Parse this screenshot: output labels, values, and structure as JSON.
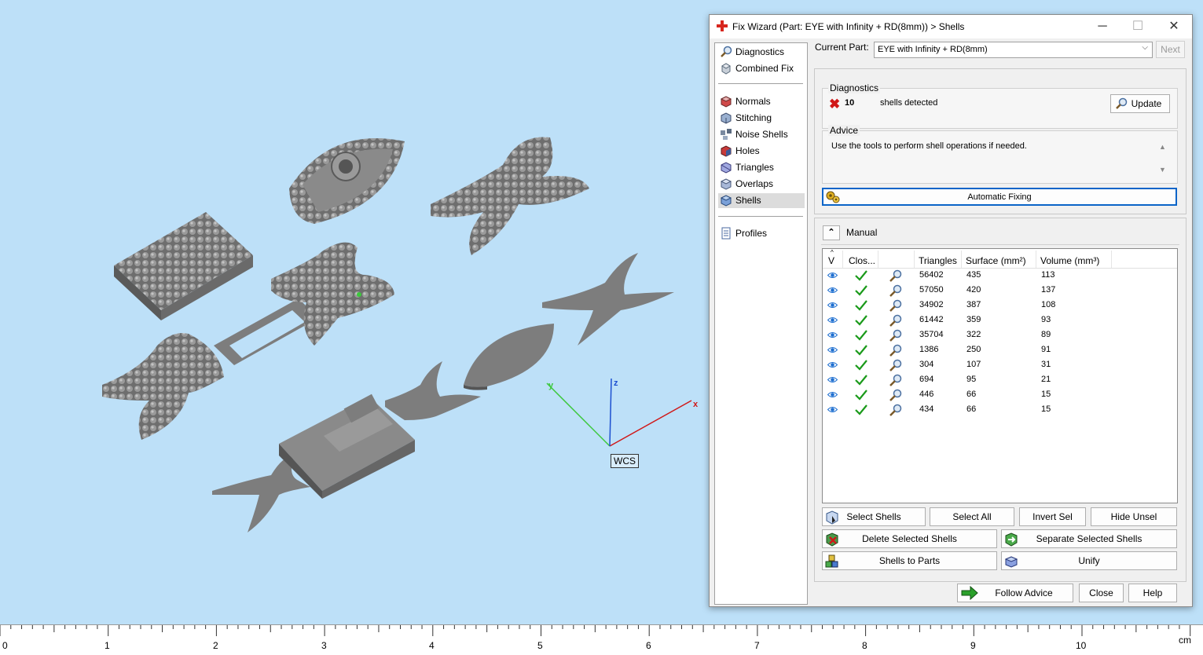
{
  "window": {
    "title": "Fix Wizard (Part: EYE with Infinity + RD(8mm)) > Shells",
    "minimize": "─",
    "maximize": "☐",
    "close": "✕"
  },
  "nav": {
    "items": [
      {
        "label": "Diagnostics",
        "icon": "magnifier-icon"
      },
      {
        "label": "Combined Fix",
        "icon": "cube-icon"
      },
      {
        "label": "Normals",
        "icon": "normals-icon"
      },
      {
        "label": "Stitching",
        "icon": "stitching-icon"
      },
      {
        "label": "Noise Shells",
        "icon": "noise-shells-icon"
      },
      {
        "label": "Holes",
        "icon": "holes-icon"
      },
      {
        "label": "Triangles",
        "icon": "triangles-icon"
      },
      {
        "label": "Overlaps",
        "icon": "overlaps-icon"
      },
      {
        "label": "Shells",
        "icon": "shells-icon"
      },
      {
        "label": "Profiles",
        "icon": "profiles-icon"
      }
    ],
    "selected": "Shells"
  },
  "current_part": {
    "label": "Current Part:",
    "value": "EYE with Infinity + RD(8mm)",
    "next": "Next"
  },
  "diagnostics": {
    "title": "Diagnostics",
    "count": "10",
    "text": "shells detected",
    "update": "Update"
  },
  "advice": {
    "title": "Advice",
    "text": "Use the tools to perform shell operations if needed."
  },
  "automatic_fixing": "Automatic Fixing",
  "manual": {
    "title": "Manual",
    "columns": [
      "V",
      "Clos...",
      "",
      "Triangles",
      "Surface (mm²)",
      "Volume (mm³)"
    ],
    "rows": [
      {
        "triangles": "56402",
        "surface": "435",
        "volume": "113"
      },
      {
        "triangles": "57050",
        "surface": "420",
        "volume": "137"
      },
      {
        "triangles": "34902",
        "surface": "387",
        "volume": "108"
      },
      {
        "triangles": "61442",
        "surface": "359",
        "volume": "93"
      },
      {
        "triangles": "35704",
        "surface": "322",
        "volume": "89"
      },
      {
        "triangles": "1386",
        "surface": "250",
        "volume": "91"
      },
      {
        "triangles": "304",
        "surface": "107",
        "volume": "31"
      },
      {
        "triangles": "694",
        "surface": "95",
        "volume": "21"
      },
      {
        "triangles": "446",
        "surface": "66",
        "volume": "15"
      },
      {
        "triangles": "434",
        "surface": "66",
        "volume": "15"
      }
    ],
    "buttons": {
      "select_shells": "Select Shells",
      "select_all": "Select All",
      "invert_sel": "Invert Sel",
      "hide_unsel": "Hide Unsel",
      "delete_selected": "Delete Selected Shells",
      "separate_selected": "Separate Selected Shells",
      "shells_to_parts": "Shells to Parts",
      "unify": "Unify"
    }
  },
  "footer": {
    "follow_advice": "Follow Advice",
    "close": "Close",
    "help": "Help"
  },
  "viewport": {
    "wcs": "WCS",
    "axis_x": "x",
    "axis_y": "y",
    "axis_z": "z",
    "ruler_labels": [
      "0",
      "1",
      "2",
      "3",
      "4",
      "5",
      "6",
      "7",
      "8",
      "9",
      "10"
    ],
    "ruler_unit": "cm"
  },
  "colors": {
    "background": "#bde0f8",
    "model": "#7d7d7d",
    "axis_x": "#d01818",
    "axis_y": "#3cc83c",
    "axis_z": "#1c4fd0",
    "check": "#1a9a1a"
  }
}
